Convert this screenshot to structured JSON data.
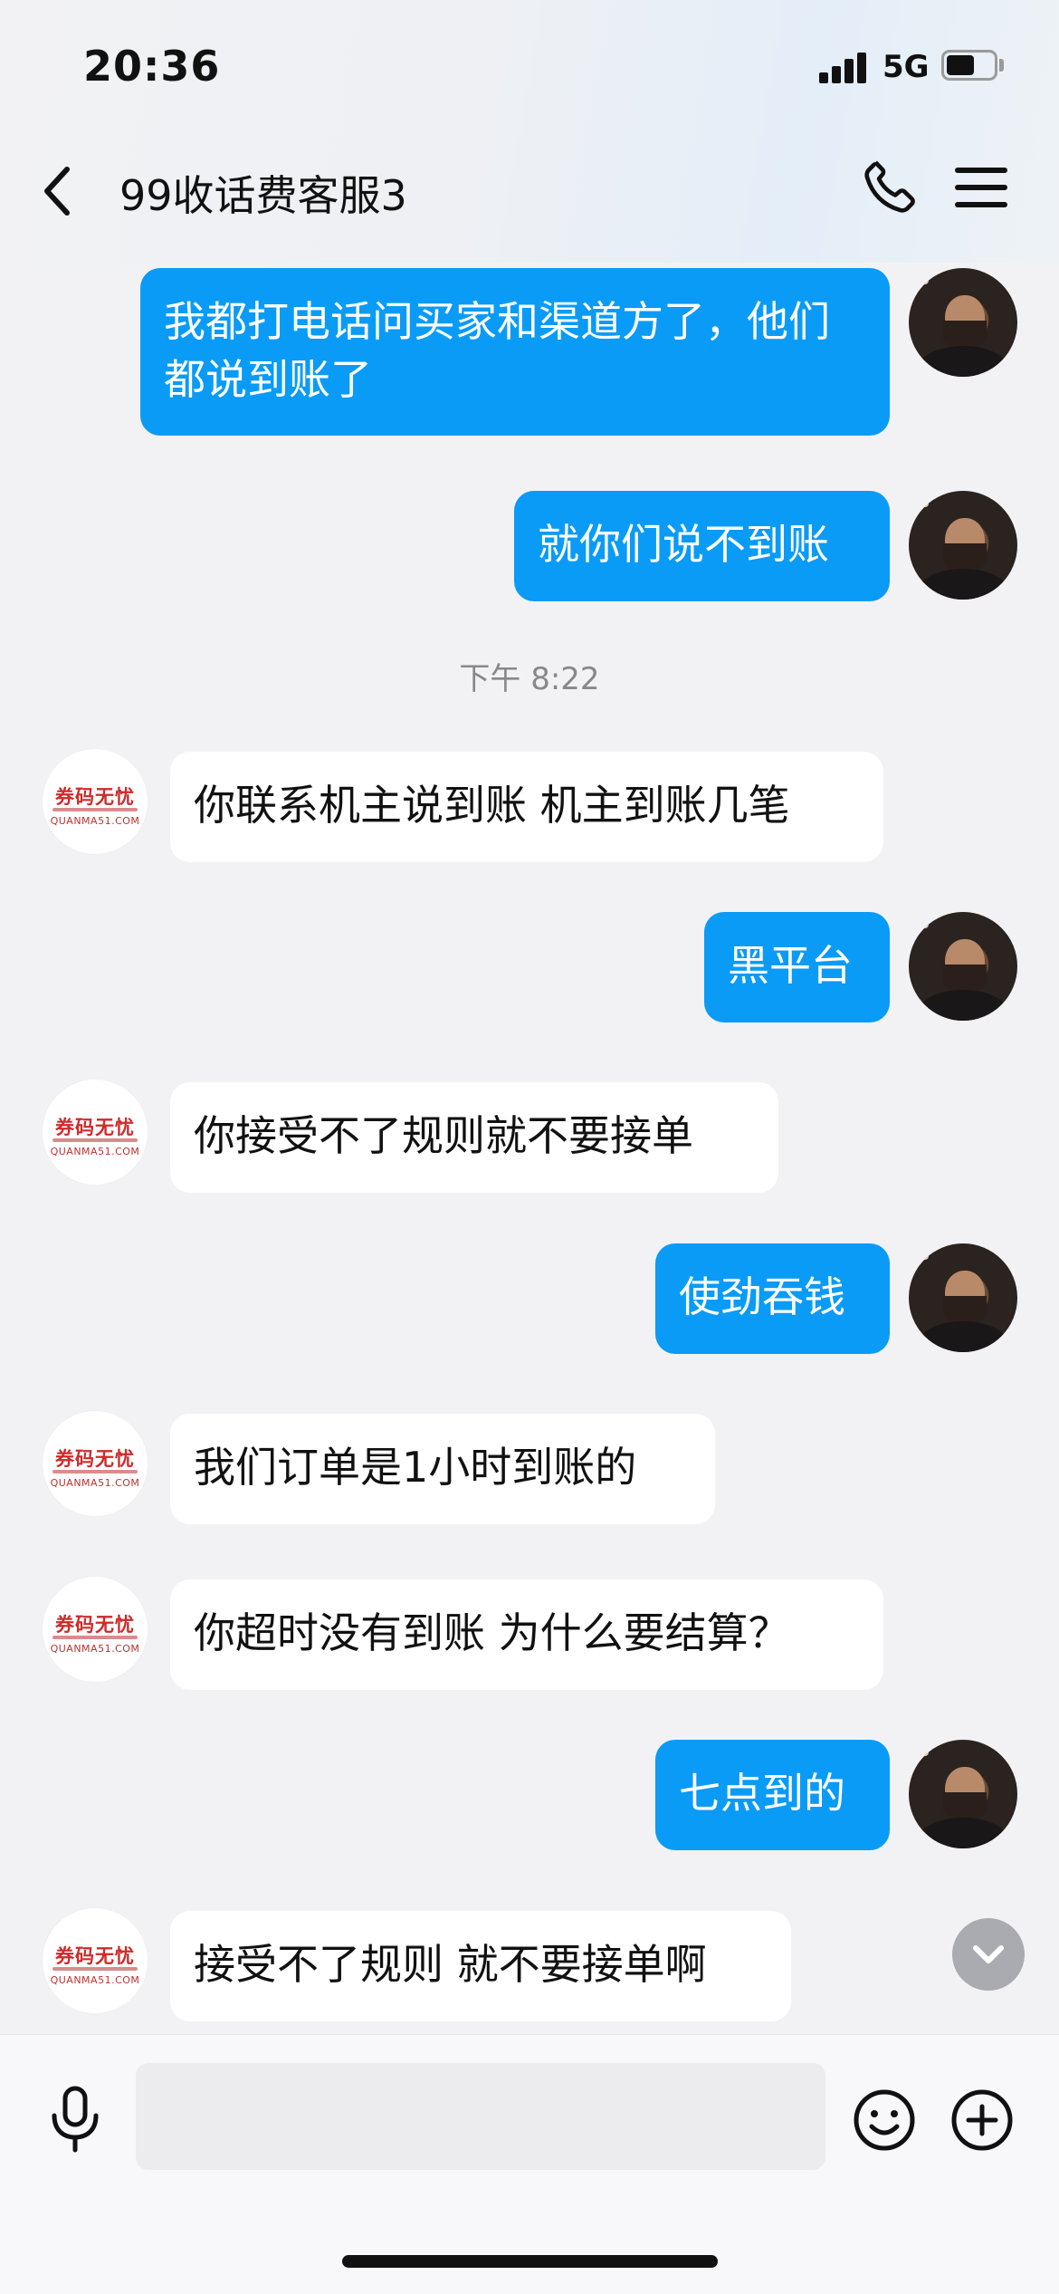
{
  "status_bar": {
    "time": "20:36",
    "network": "5G"
  },
  "header": {
    "title": "99收话费客服3",
    "back_icon": "chevron-left-icon",
    "call_icon": "phone-icon",
    "menu_icon": "hamburger-menu-icon"
  },
  "timestamp": "下午 8:22",
  "messages": [
    {
      "side": "out",
      "text": "我都打电话问买家和渠道方了，他们都说到账了"
    },
    {
      "side": "out",
      "text": "就你们说不到账"
    },
    {
      "side": "in",
      "text": "你联系机主说到账 机主到账几笔"
    },
    {
      "side": "out",
      "text": "黑平台"
    },
    {
      "side": "in",
      "text": "你接受不了规则就不要接单"
    },
    {
      "side": "out",
      "text": "使劲吞钱"
    },
    {
      "side": "in",
      "text": "我们订单是1小时到账的"
    },
    {
      "side": "in",
      "text": "你超时没有到账 为什么要结算？"
    },
    {
      "side": "out",
      "text": "七点到的"
    },
    {
      "side": "in",
      "text": "接受不了规则 就不要接单啊"
    }
  ],
  "shop_avatar": {
    "logo_text": "券码无忧",
    "domain": "QUANMA51.COM"
  },
  "input_bar": {
    "placeholder": "",
    "mic_icon": "microphone-icon",
    "emoji_icon": "smiley-icon",
    "plus_icon": "plus-circle-icon"
  },
  "colors": {
    "outgoing_bubble": "#0a9bf7",
    "incoming_bubble": "#ffffff",
    "background": "#f2f2f4"
  }
}
